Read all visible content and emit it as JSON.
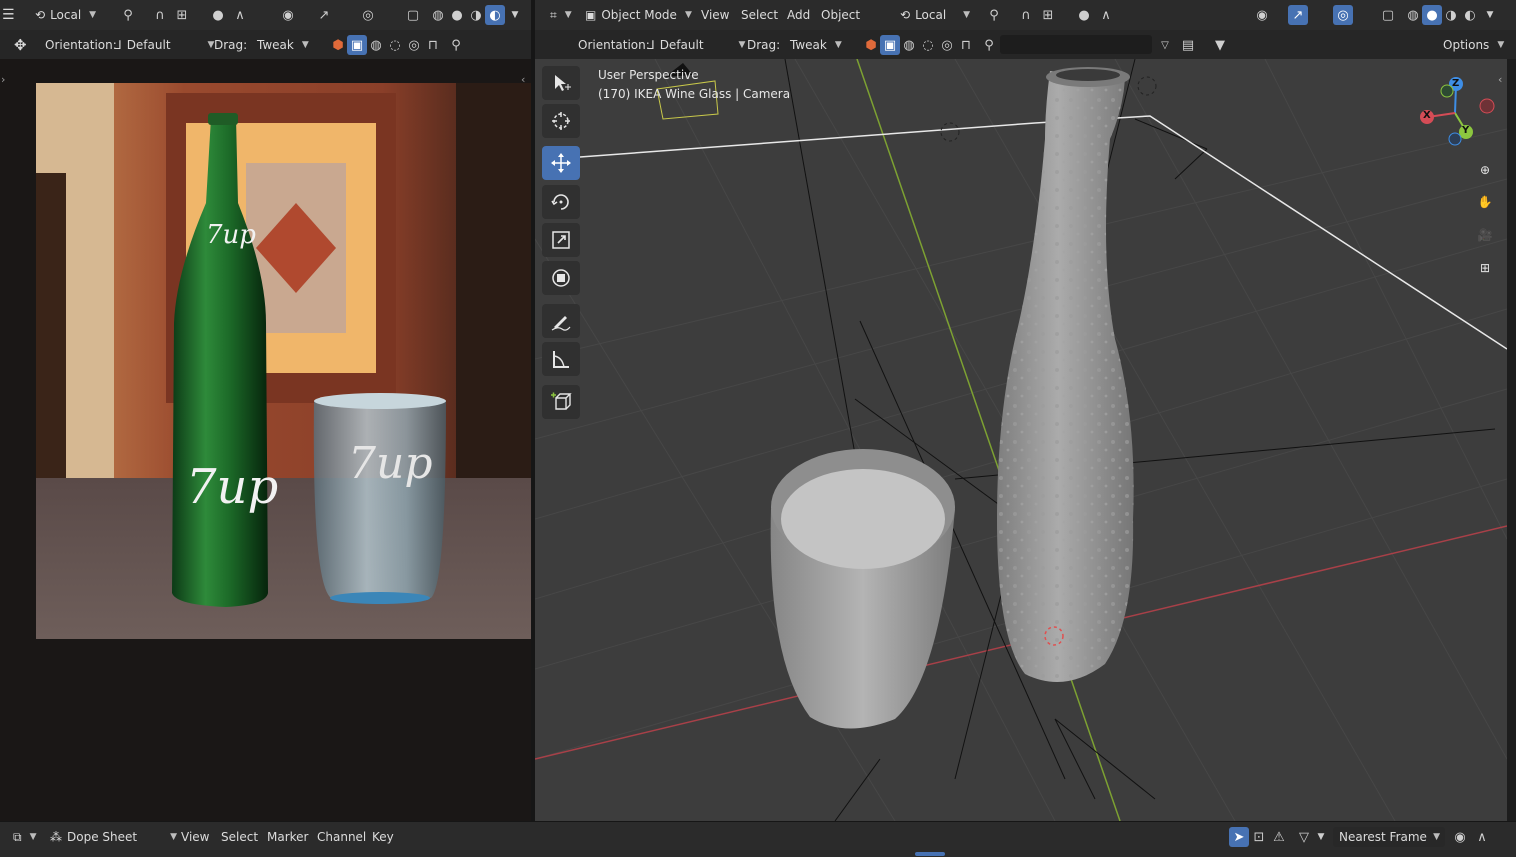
{
  "left_header": {
    "pivot": "Local",
    "orientation_label": "Orientation:",
    "orientation_value": "Default",
    "drag_label": "Drag:",
    "drag_value": "Tweak"
  },
  "right_header": {
    "mode": "Object Mode",
    "menus": [
      "View",
      "Select",
      "Add",
      "Object"
    ],
    "pivot": "Local",
    "orientation_label": "Orientation:",
    "orientation_value": "Default",
    "drag_label": "Drag:",
    "drag_value": "Tweak",
    "options_label": "Options"
  },
  "viewport": {
    "perspective": "User Perspective",
    "object_info": "(170) IKEA Wine Glass | Camera",
    "gizmo": {
      "x": "X",
      "y": "Y",
      "z": "Z"
    }
  },
  "render": {
    "bottle_logo": "7up",
    "glass_logo": "7up"
  },
  "bottom_bar": {
    "editor": "Dope Sheet",
    "menus": [
      "View",
      "Select",
      "Marker",
      "Channel",
      "Key"
    ],
    "snap": "Nearest Frame"
  },
  "colors": {
    "accent": "#4772b3",
    "x_axis": "#d44c56",
    "y_axis": "#8cc63f",
    "z_axis": "#3e8ee6",
    "viewport_bg": "#3d3d3d",
    "header_bg": "#2b2b2b"
  }
}
